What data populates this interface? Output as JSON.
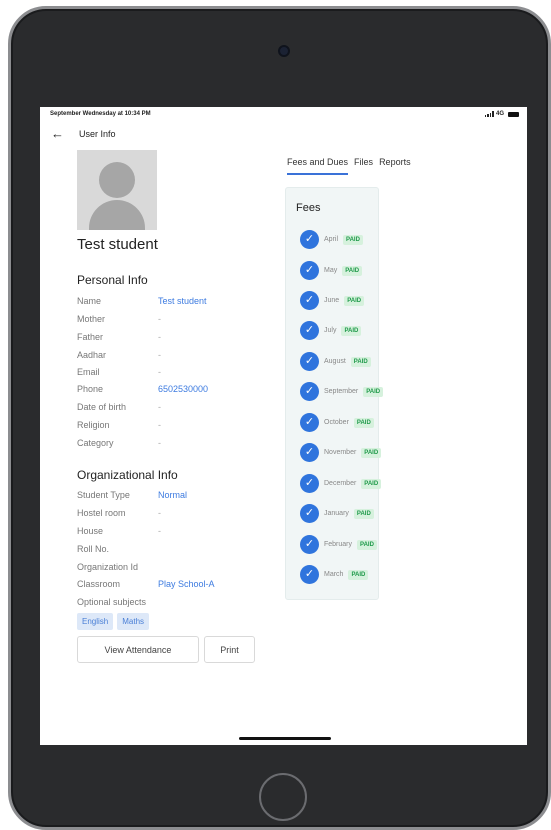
{
  "status_bar": {
    "time": "September Wednesday at 10:34 PM",
    "network": "4G"
  },
  "header": {
    "title": "User Info"
  },
  "student": {
    "name": "Test student"
  },
  "personal_info": {
    "title": "Personal Info",
    "rows": [
      {
        "label": "Name",
        "value": "Test student"
      },
      {
        "label": "Mother",
        "value": "-"
      },
      {
        "label": "Father",
        "value": "-"
      },
      {
        "label": "Aadhar",
        "value": "-"
      },
      {
        "label": "Email",
        "value": "-"
      },
      {
        "label": "Phone",
        "value": "6502530000"
      },
      {
        "label": "Date of birth",
        "value": "-"
      },
      {
        "label": "Religion",
        "value": "-"
      },
      {
        "label": "Category",
        "value": "-"
      }
    ]
  },
  "org_info": {
    "title": "Organizational Info",
    "rows": [
      {
        "label": "Student Type",
        "value": "Normal"
      },
      {
        "label": "Hostel room",
        "value": "-"
      },
      {
        "label": "House",
        "value": "-"
      },
      {
        "label": "Roll No.",
        "value": ""
      },
      {
        "label": "Organization Id",
        "value": ""
      },
      {
        "label": "Classroom",
        "value": "Play School-A"
      },
      {
        "label": "Optional subjects",
        "value": ""
      }
    ],
    "subjects": [
      "English",
      "Maths"
    ]
  },
  "buttons": {
    "view_attendance": "View Attendance",
    "print": "Print"
  },
  "tabs": [
    "Fees and Dues",
    "Files",
    "Reports"
  ],
  "fees": {
    "title": "Fees",
    "status_label": "PAID",
    "months": [
      "April",
      "May",
      "June",
      "July",
      "August",
      "September",
      "October",
      "November",
      "December",
      "January",
      "February",
      "March"
    ]
  },
  "colors": {
    "accent": "#2f74dd",
    "paid_bg": "#d6f1dd",
    "paid_text": "#1f9a4a",
    "link": "#3d7be0"
  }
}
